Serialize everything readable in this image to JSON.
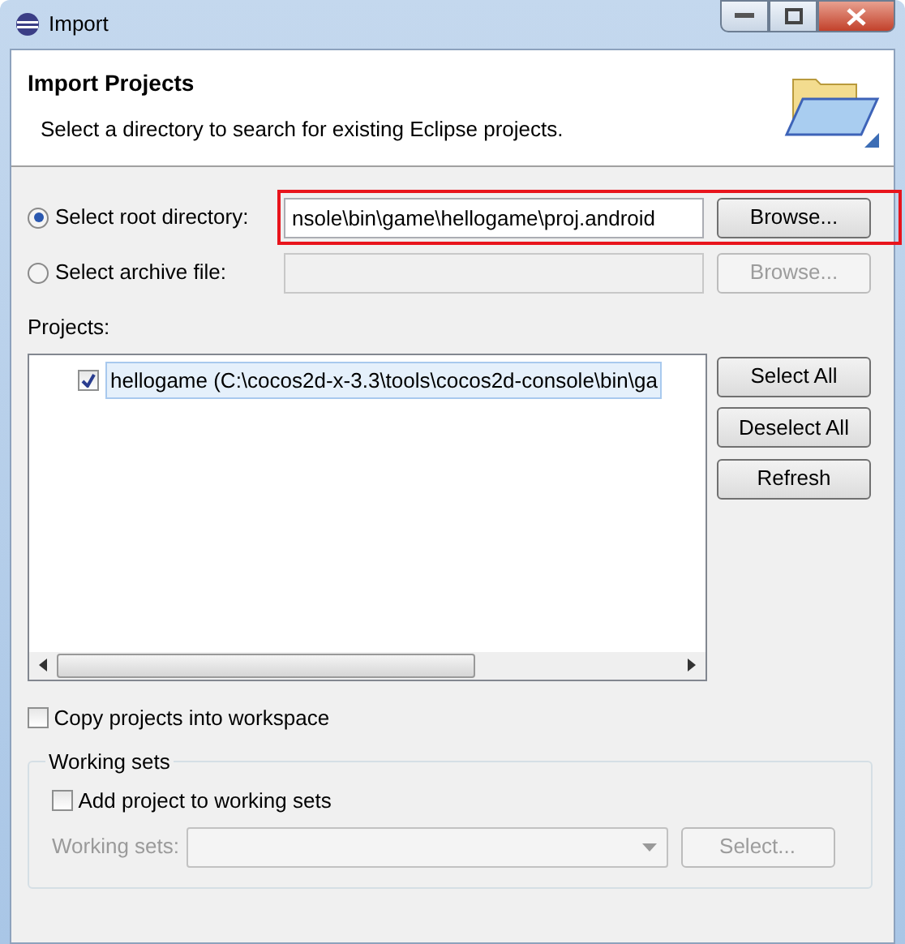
{
  "window": {
    "title": "Import"
  },
  "header": {
    "title": "Import Projects",
    "description": "Select a directory to search for existing Eclipse projects."
  },
  "sources": [
    {
      "label": "Select root directory:",
      "selected": true,
      "value": "nsole\\bin\\game\\hellogame\\proj.android",
      "disabled": false,
      "highlighted": true,
      "button": "Browse..."
    },
    {
      "label": "Select archive file:",
      "selected": false,
      "disabled": true,
      "highlighted": false,
      "button": "Browse..."
    }
  ],
  "projects": {
    "label": "Projects:",
    "items": [
      {
        "label": "hellogame (C:\\cocos2d-x-3.3\\tools\\cocos2d-console\\bin\\ga",
        "checked": true,
        "selected": true
      }
    ],
    "buttons": [
      "Select All",
      "Deselect All",
      "Refresh"
    ]
  },
  "copy": {
    "label": "Copy projects into workspace",
    "checked": false
  },
  "working_sets": {
    "legend": "Working sets",
    "add": {
      "label": "Add project to working sets",
      "checked": false
    },
    "combo_label": "Working sets:",
    "disabled": true,
    "button": "Select..."
  }
}
